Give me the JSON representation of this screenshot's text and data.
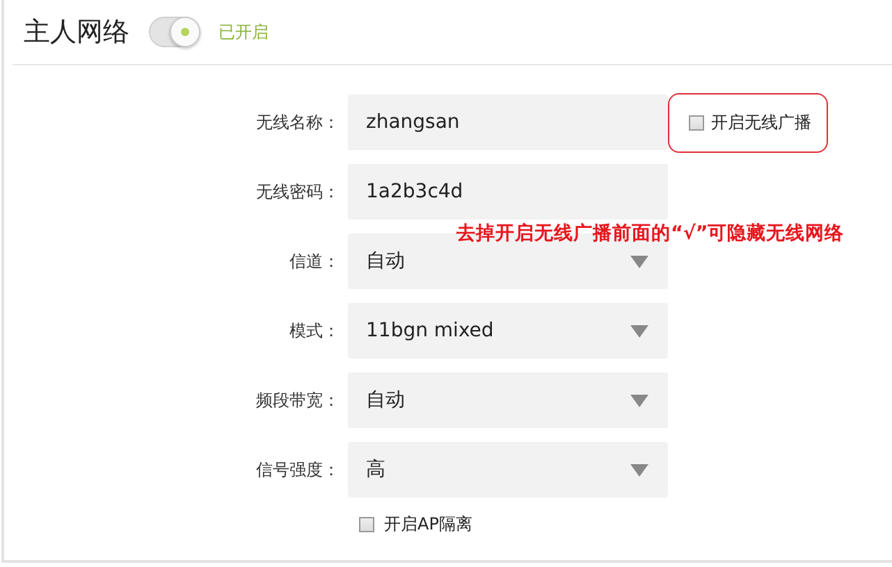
{
  "header": {
    "title": "主人网络",
    "toggle": {
      "on": true
    },
    "status": "已开启"
  },
  "fields": [
    {
      "label": "无线名称：",
      "kind": "text",
      "value": "zhangsan",
      "option": {
        "label": "开启无线广播",
        "checked": false,
        "highlighted": true
      }
    },
    {
      "label": "无线密码：",
      "kind": "text",
      "value": "1a2b3c4d"
    },
    {
      "label": "信道：",
      "kind": "select",
      "value": "自动"
    },
    {
      "label": "模式：",
      "kind": "select",
      "value": "11bgn mixed"
    },
    {
      "label": "频段带宽：",
      "kind": "select",
      "value": "自动"
    },
    {
      "label": "信号强度：",
      "kind": "select",
      "value": "高"
    }
  ],
  "ap_isolation": {
    "label": "开启AP隔离",
    "checked": false
  },
  "annotation": "去掉开启无线广播前面的“√”可隐藏无线网络"
}
